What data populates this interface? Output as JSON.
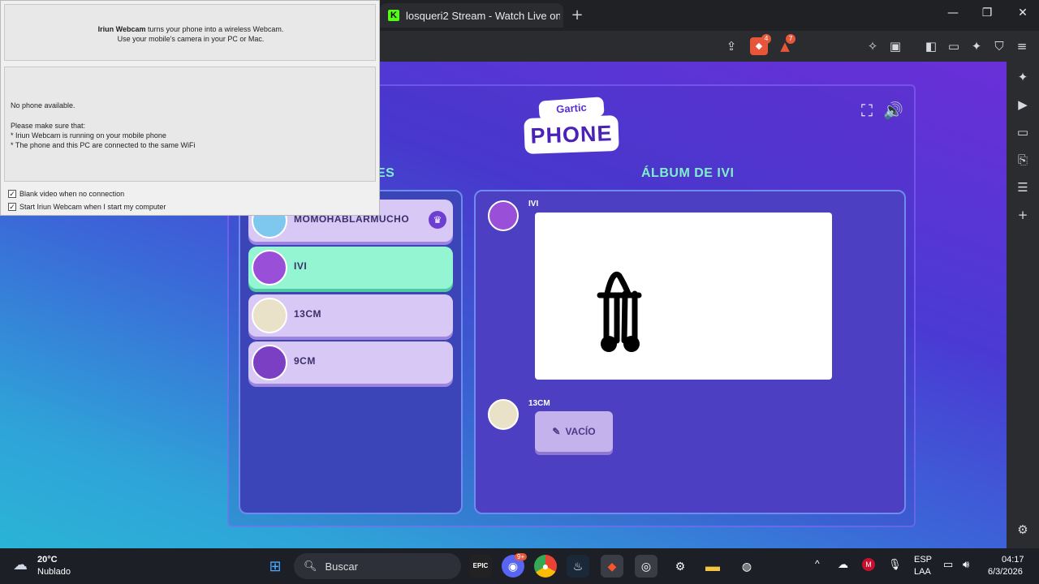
{
  "browser": {
    "tab_title": "losqueri2 Stream - Watch Live on Kick",
    "tab_icon": "kick-icon",
    "brave_badge": "4",
    "rewards_badge": "7"
  },
  "iriun": {
    "brand": "Iriun Webcam",
    "intro_rest": " turns your phone into a wireless Webcam.",
    "intro_line2": "Use your mobile's camera in your PC or Mac.",
    "status": "No phone available.",
    "instructions_title": "Please make sure that:",
    "instruction_1": "* Iriun Webcam is running on your mobile phone",
    "instruction_2": "* The phone and this PC are connected to the same WiFi",
    "option_1": "Blank video when no connection",
    "option_2": "Start Iriun Webcam when I start my computer"
  },
  "game": {
    "logo_top": "Gartic",
    "logo_bottom": "PHONE",
    "players_title_fragment": "ES",
    "album_title": "ÁLBUM DE IVI",
    "players": [
      {
        "name": "MOMOHABLARMUCHO",
        "host": true
      },
      {
        "name": "IVI",
        "active": true
      },
      {
        "name": "13CM"
      },
      {
        "name": "9CM"
      }
    ],
    "album": [
      {
        "author": "IVI",
        "type": "drawing"
      },
      {
        "author": "13CM",
        "type": "empty",
        "empty_label": "VACÍO"
      }
    ]
  },
  "taskbar": {
    "weather_temp": "20°C",
    "weather_desc": "Nublado",
    "search_placeholder": "Buscar",
    "discord_badge": "9+",
    "lang_1": "ESP",
    "lang_2": "LAA",
    "time": "04:17",
    "date": "6/3/2026"
  }
}
